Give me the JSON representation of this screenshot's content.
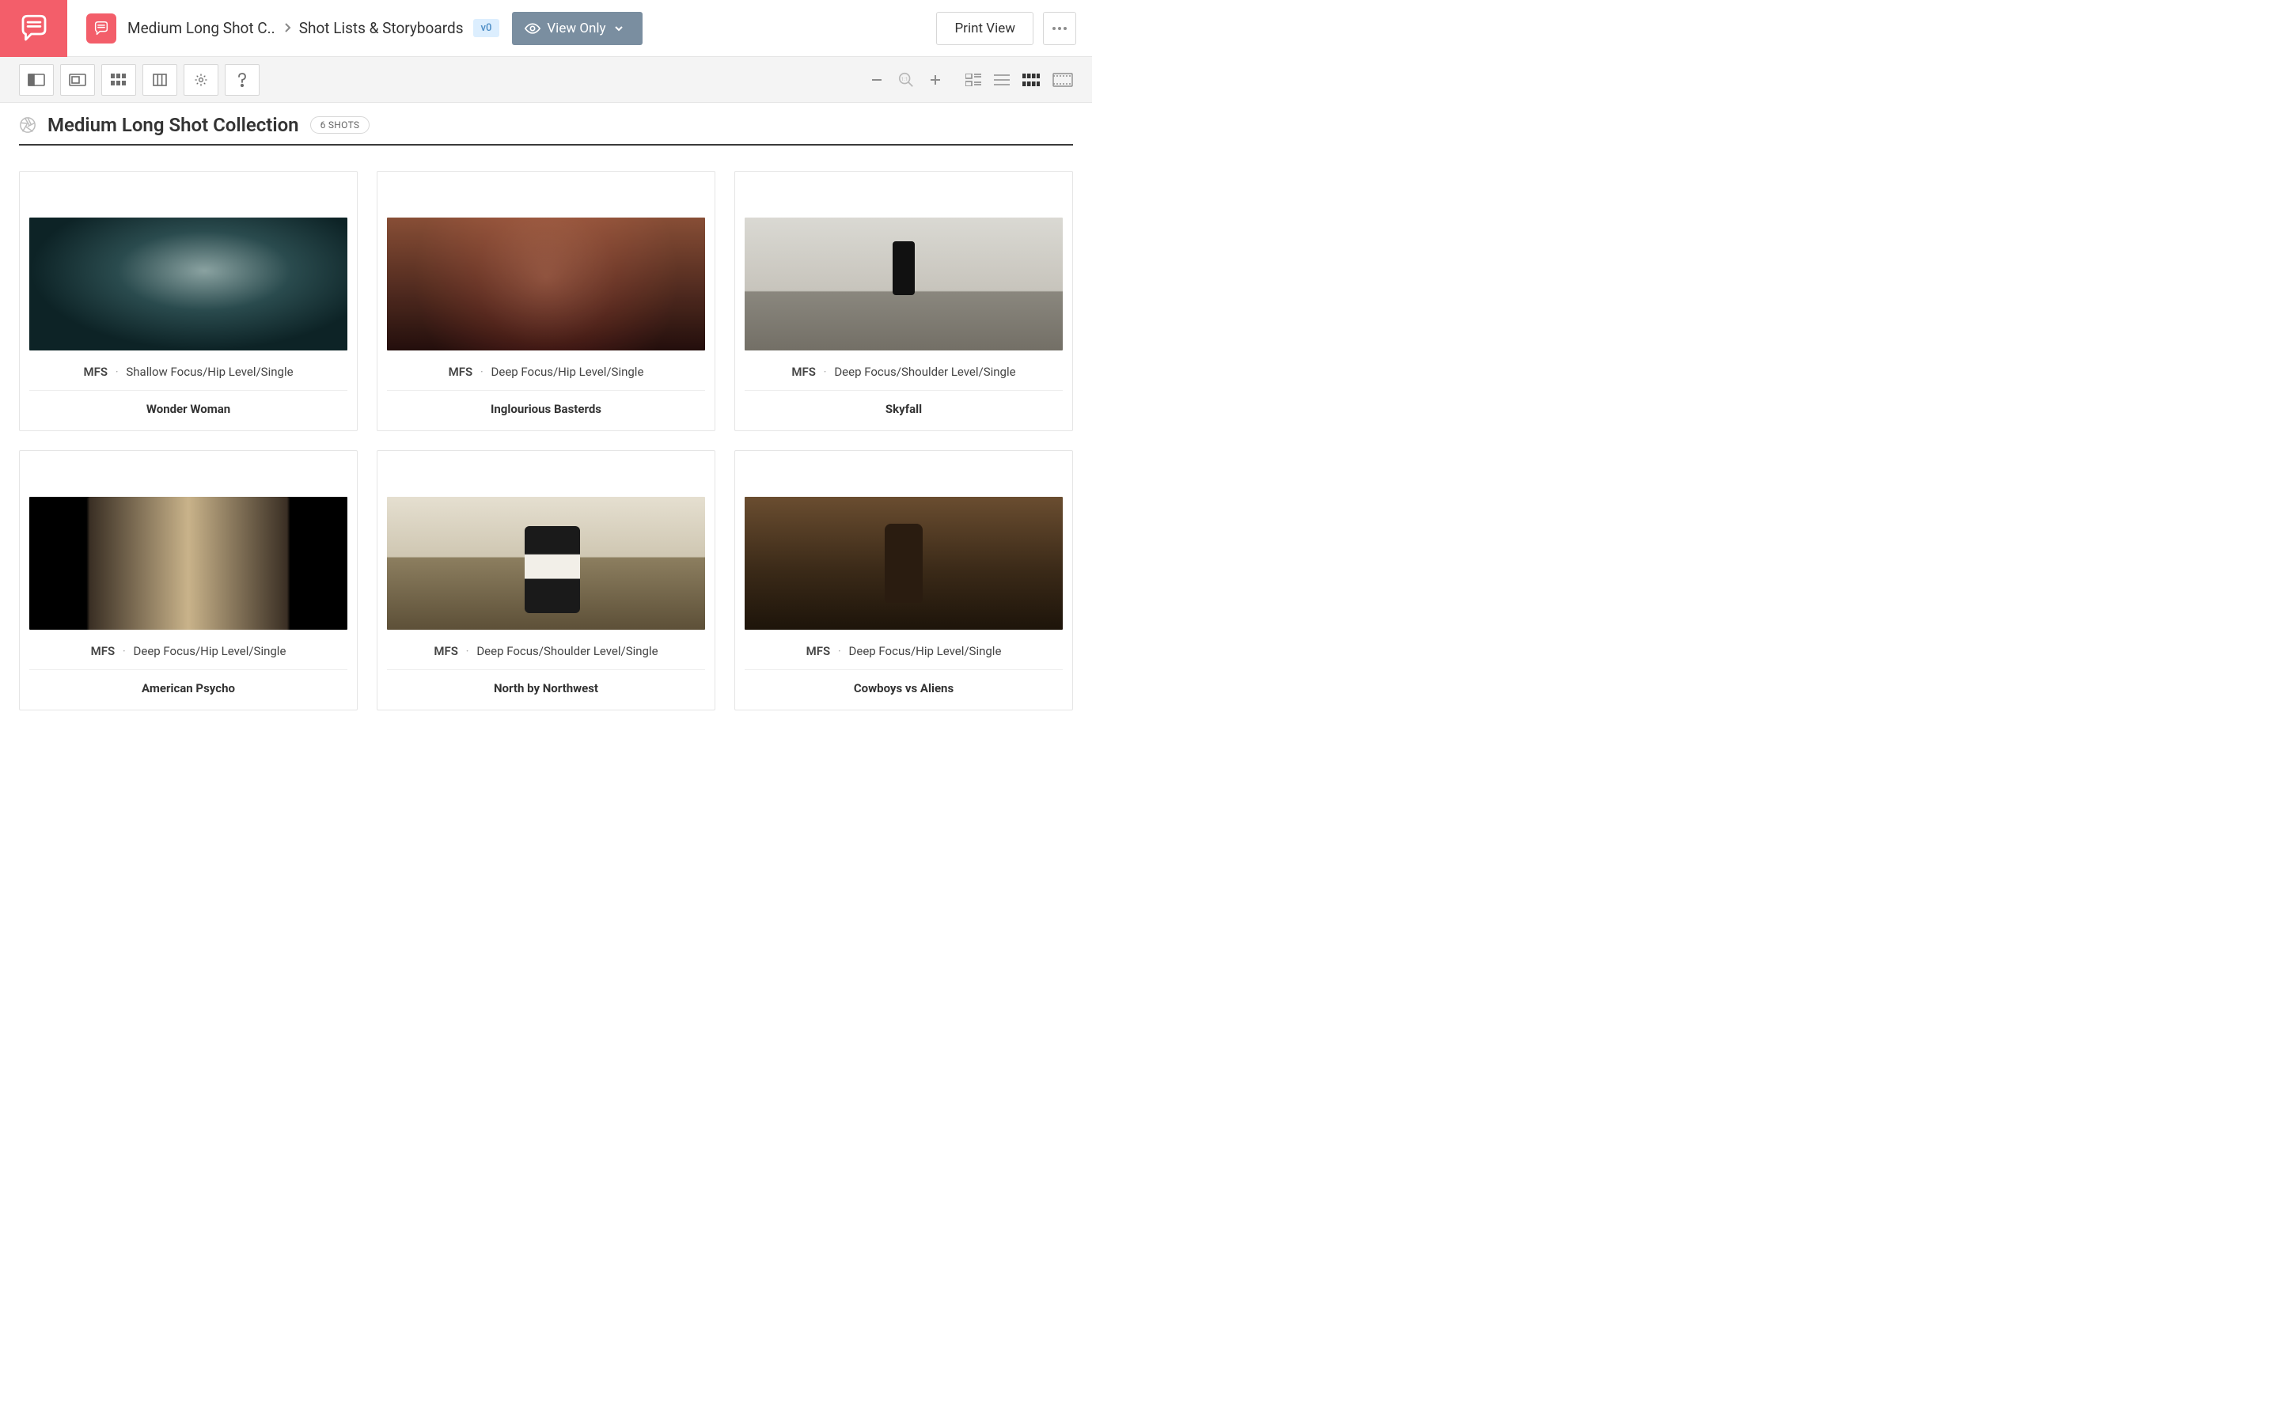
{
  "header": {
    "breadcrumb1": "Medium Long Shot C..",
    "breadcrumb2": "Shot Lists & Storyboards",
    "version": "v0",
    "view_mode": "View Only",
    "print": "Print View"
  },
  "page": {
    "title": "Medium Long Shot Collection",
    "shots_count": "6 SHOTS"
  },
  "shots": [
    {
      "size": "MFS",
      "details": "Shallow Focus/Hip Level/Single",
      "film": "Wonder Woman"
    },
    {
      "size": "MFS",
      "details": "Deep Focus/Hip Level/Single",
      "film": "Inglourious Basterds"
    },
    {
      "size": "MFS",
      "details": "Deep Focus/Shoulder Level/Single",
      "film": "Skyfall"
    },
    {
      "size": "MFS",
      "details": "Deep Focus/Hip Level/Single",
      "film": "American Psycho"
    },
    {
      "size": "MFS",
      "details": "Deep Focus/Shoulder Level/Single",
      "film": "North by Northwest"
    },
    {
      "size": "MFS",
      "details": "Deep Focus/Hip Level/Single",
      "film": "Cowboys vs Aliens"
    }
  ]
}
